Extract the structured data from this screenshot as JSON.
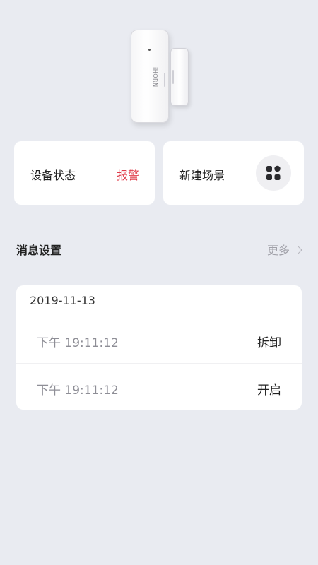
{
  "device": {
    "brand_text": "iHORN"
  },
  "status_card": {
    "label": "设备状态",
    "value": "报警"
  },
  "scene_card": {
    "label": "新建场景",
    "icon": "apps-grid-icon"
  },
  "messages_section": {
    "title": "消息设置",
    "more_label": "更多"
  },
  "message_log": {
    "date": "2019-11-13",
    "entries": [
      {
        "time": "下午 19:11:12",
        "action": "拆卸"
      },
      {
        "time": "下午 19:11:12",
        "action": "开启"
      }
    ]
  },
  "colors": {
    "alert": "#e03d4b",
    "background": "#e9ebf1"
  }
}
